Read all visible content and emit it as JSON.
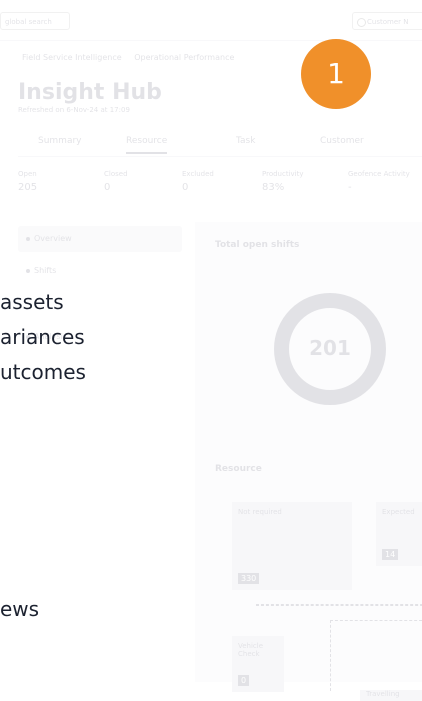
{
  "app": {
    "search_placeholder": "global search",
    "customer_nav": "Customer N",
    "breadcrumb": [
      "Field Service Intelligence",
      "Operational Performance"
    ],
    "title": "Insight Hub",
    "subtitle": "Refreshed on 6-Nov-24 at 17:09",
    "tabs": [
      "Summary",
      "Resource",
      "Task",
      "Customer"
    ],
    "stats": [
      {
        "label": "Open",
        "value": "205"
      },
      {
        "label": "Closed",
        "value": "0"
      },
      {
        "label": "Excluded",
        "value": "0"
      },
      {
        "label": "Productivity",
        "value": "83%"
      },
      {
        "label": "Geofence Activity",
        "value": "-"
      }
    ],
    "sidebar": [
      "Overview",
      "Shifts",
      "Analysis"
    ],
    "card_title": "Total open shifts",
    "donut_value": "201",
    "resource_title": "Resource",
    "resource_boxes": [
      {
        "label": "Not required",
        "value": "330"
      },
      {
        "label": "Expected",
        "value": "14"
      },
      {
        "label": "Vehicle Check",
        "value": "0"
      },
      {
        "label": "Travelling",
        "value": ""
      }
    ]
  },
  "overlay": {
    "lines": [
      "assets",
      "ariances",
      "utcomes",
      "ews"
    ],
    "step_number": "1"
  },
  "colors": {
    "badge": "#f0902a",
    "text": "#1c2230"
  }
}
